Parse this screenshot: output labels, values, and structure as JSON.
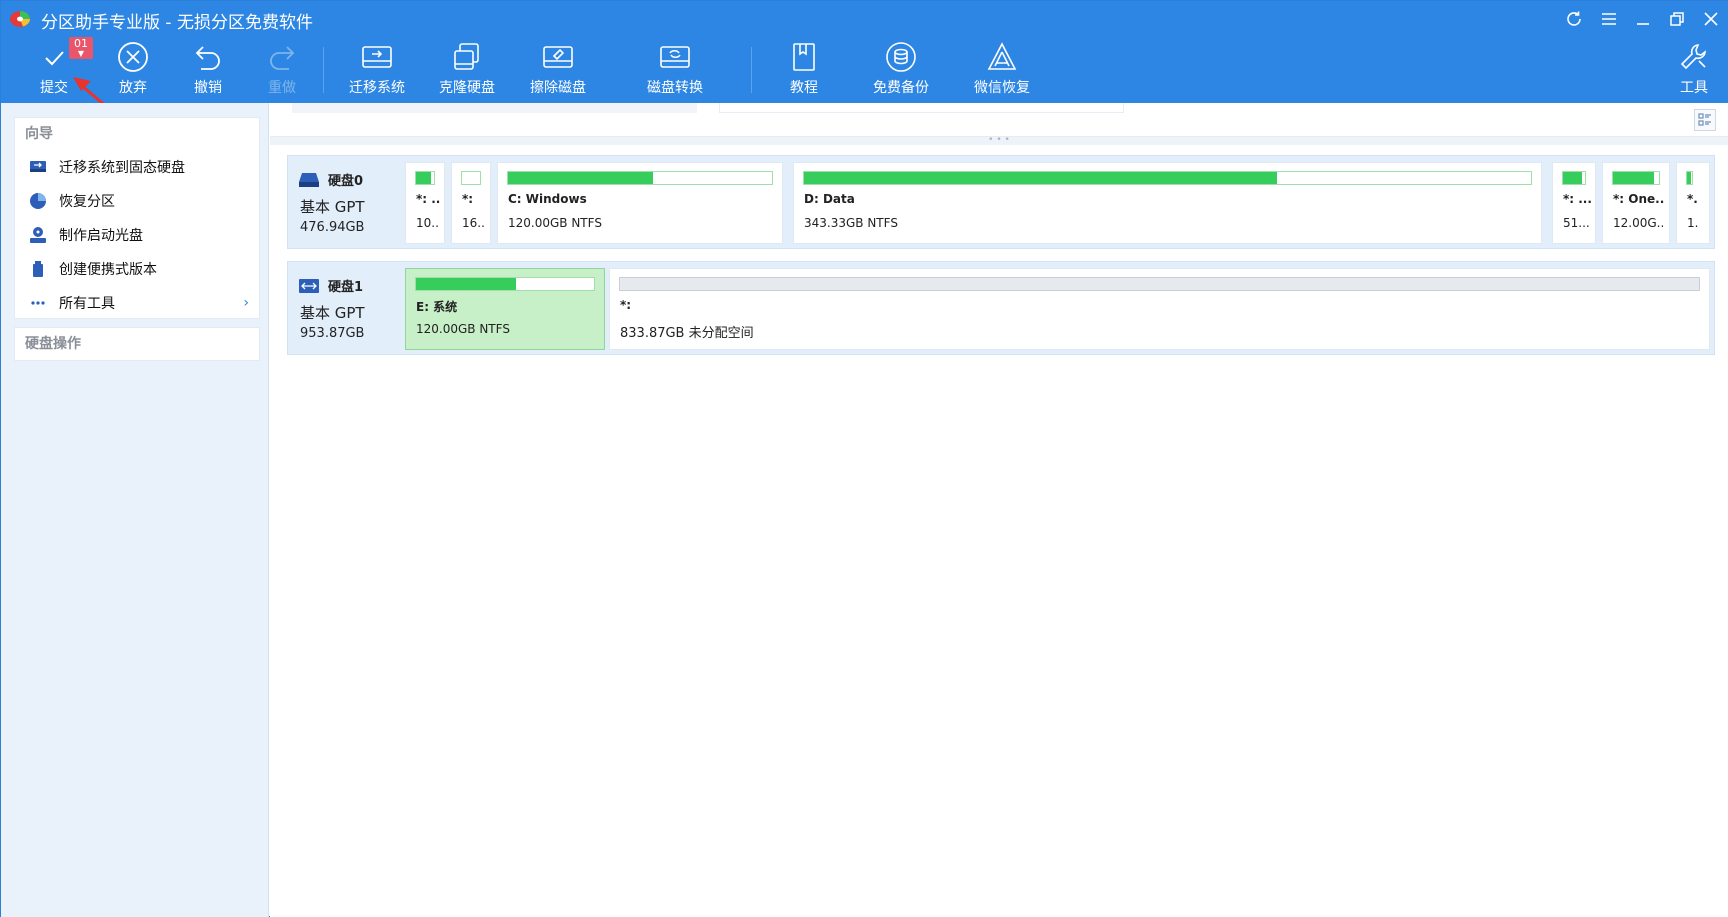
{
  "window": {
    "title": "分区助手专业版 - 无损分区免费软件"
  },
  "toolbar": {
    "commit": {
      "label": "提交",
      "badge": "01"
    },
    "discard": {
      "label": "放弃"
    },
    "undo": {
      "label": "撤销"
    },
    "redo": {
      "label": "重做"
    },
    "migrate": {
      "label": "迁移系统"
    },
    "clone": {
      "label": "克隆硬盘"
    },
    "wipe": {
      "label": "擦除磁盘"
    },
    "convert": {
      "label": "磁盘转换"
    },
    "tutorial": {
      "label": "教程"
    },
    "backup": {
      "label": "免费备份"
    },
    "wechat": {
      "label": "微信恢复"
    },
    "tools": {
      "label": "工具"
    }
  },
  "sidebar": {
    "wizard_title": "向导",
    "wizard_items": [
      {
        "label": "迁移系统到固态硬盘",
        "icon": "migrate-ssd-icon"
      },
      {
        "label": "恢复分区",
        "icon": "recover-partition-icon"
      },
      {
        "label": "制作启动光盘",
        "icon": "boot-disc-icon"
      },
      {
        "label": "创建便携式版本",
        "icon": "portable-version-icon"
      },
      {
        "label": "所有工具",
        "icon": "more-dots-icon"
      }
    ],
    "disk_ops_title": "硬盘操作"
  },
  "disks": [
    {
      "name": "硬盘0",
      "type": "基本 GPT",
      "size": "476.94GB",
      "partitions": [
        {
          "name": "*: ...",
          "info": "10...",
          "used": 0.85
        },
        {
          "name": "*:",
          "info": "16...",
          "used": 0.0
        },
        {
          "name": "C: Windows",
          "info": "120.00GB NTFS",
          "used": 0.55
        },
        {
          "name": "D: Data",
          "info": "343.33GB NTFS",
          "used": 0.65
        },
        {
          "name": "*: ...",
          "info": "51...",
          "used": 0.85
        },
        {
          "name": "*: One...",
          "info": "12.00G...",
          "used": 0.9
        },
        {
          "name": "*.",
          "info": "1.",
          "used": 0.8
        }
      ]
    },
    {
      "name": "硬盘1",
      "type": "基本 GPT",
      "size": "953.87GB",
      "partitions": [
        {
          "name": "E: 系统",
          "info": "120.00GB NTFS",
          "used": 0.56,
          "selected": true
        },
        {
          "name": "*:",
          "info": "833.87GB 未分配空间",
          "used": 0,
          "unallocated": true
        }
      ]
    }
  ],
  "colors": {
    "accent": "#2d86e3",
    "used_fill": "#36cd5c",
    "selected_bg": "#c8f0c8",
    "badge": "#e9566b"
  }
}
